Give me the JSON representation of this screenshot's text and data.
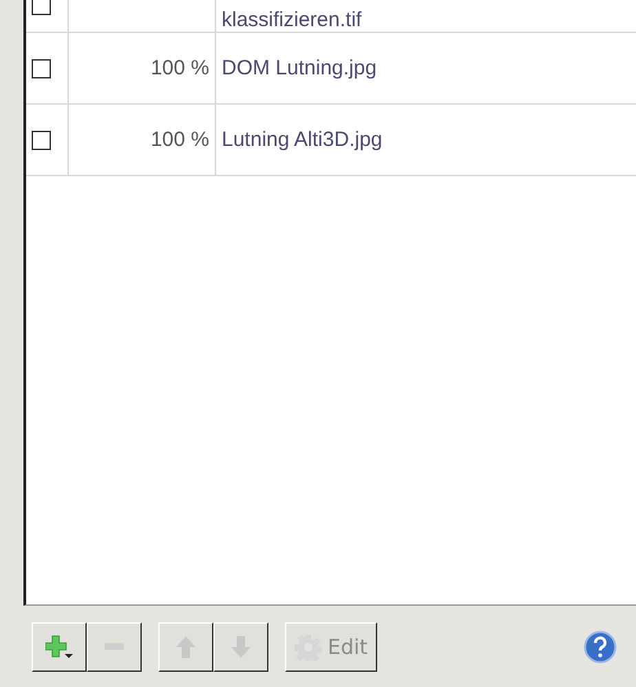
{
  "rows": [
    {
      "checked": false,
      "percent": "",
      "name": "klassifizieren.tif",
      "partial": true
    },
    {
      "checked": false,
      "percent": "100 %",
      "name": "DOM Lutning.jpg",
      "partial": false
    },
    {
      "checked": false,
      "percent": "100 %",
      "name": "Lutning Alti3D.jpg",
      "partial": false
    }
  ],
  "toolbar": {
    "buttons": [
      {
        "kind": "add",
        "disabled": false
      },
      {
        "kind": "remove",
        "disabled": true
      },
      {
        "kind": "up",
        "disabled": true
      },
      {
        "kind": "down",
        "disabled": true
      },
      {
        "kind": "edit",
        "label": "Edit",
        "disabled": true
      }
    ]
  }
}
